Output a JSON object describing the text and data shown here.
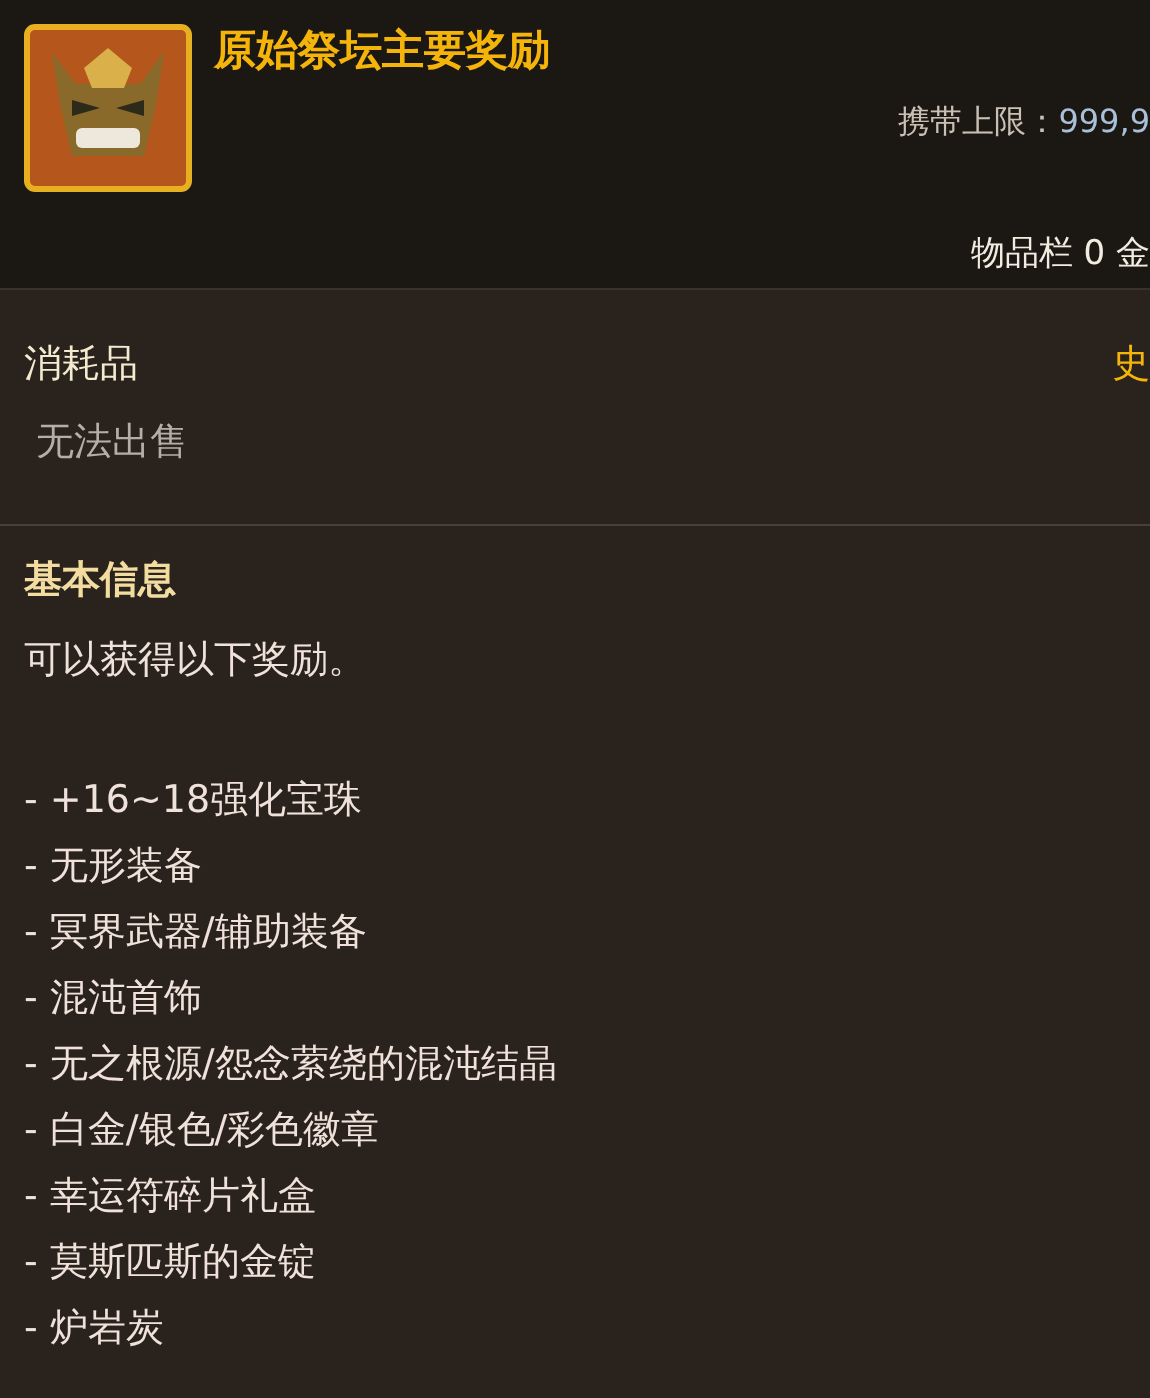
{
  "item": {
    "name": "原始祭坛主要奖励",
    "carry_limit_label": "携带上限：",
    "carry_limit_value": "999,9",
    "inventory": "物品栏 0 金"
  },
  "type": {
    "category": "消耗品",
    "rarity": "史",
    "trade": "无法出售"
  },
  "basic_info": {
    "heading": "基本信息",
    "intro": "可以获得以下奖励。",
    "rewards": [
      "- +16~18强化宝珠",
      "- 无形装备",
      "- 冥界武器/辅助装备",
      "- 混沌首饰",
      "- 无之根源/怨念萦绕的混沌结晶",
      "- 白金/银色/彩色徽章",
      "- 幸运符碎片礼盒",
      "- 莫斯匹斯的金锭",
      "- 炉岩炭"
    ]
  }
}
